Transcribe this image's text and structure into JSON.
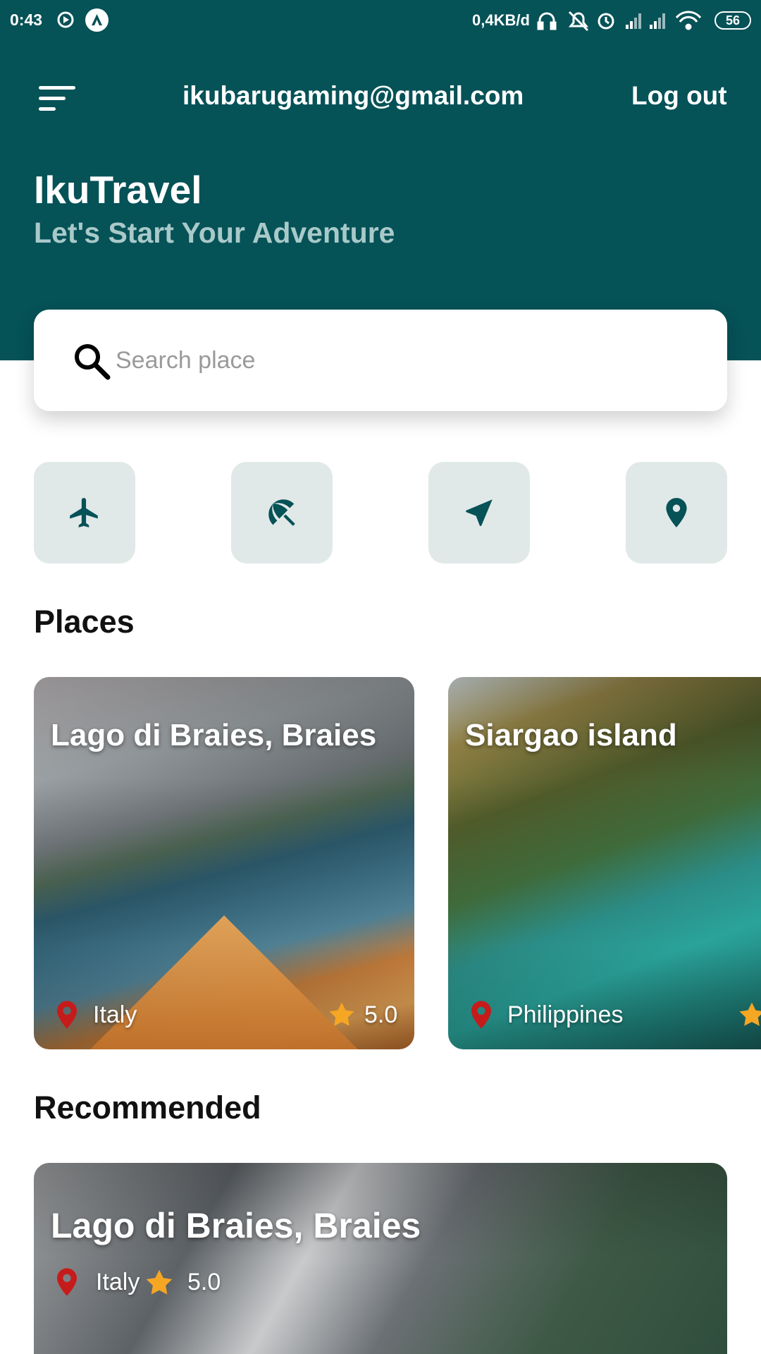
{
  "status_bar": {
    "time": "0:43",
    "network_speed": "0,4KB/d",
    "battery": "56",
    "icons": [
      "sync-icon",
      "app-notification-icon",
      "headphones-icon",
      "bell-off-icon",
      "alarm-icon",
      "signal-icon",
      "signal-icon",
      "wifi-icon",
      "battery-icon"
    ]
  },
  "header": {
    "menu_icon": "menu-icon",
    "email": "ikubarugaming@gmail.com",
    "logout_label": "Log out",
    "title": "IkuTravel",
    "subtitle": "Let's Start Your Adventure",
    "background_color": "#055257"
  },
  "search": {
    "icon": "search-icon",
    "placeholder": "Search place",
    "value": ""
  },
  "categories": [
    {
      "icon": "airplane-icon"
    },
    {
      "icon": "beach-umbrella-icon"
    },
    {
      "icon": "navigation-arrow-icon"
    },
    {
      "icon": "location-pin-icon"
    }
  ],
  "places": {
    "title": "Places",
    "items": [
      {
        "name": "Lago di Braies, Braies",
        "country": "Italy",
        "rating": "5.0"
      },
      {
        "name": "Siargao island",
        "country": "Philippines",
        "rating": ""
      }
    ]
  },
  "recommended": {
    "title": "Recommended",
    "items": [
      {
        "name": "Lago di Braies, Braies",
        "country": "Italy",
        "rating": "5.0"
      }
    ]
  },
  "colors": {
    "primary": "#055257",
    "category_bg": "#e1e8e8",
    "pin": "#c61b1b",
    "star": "#f5a623"
  }
}
